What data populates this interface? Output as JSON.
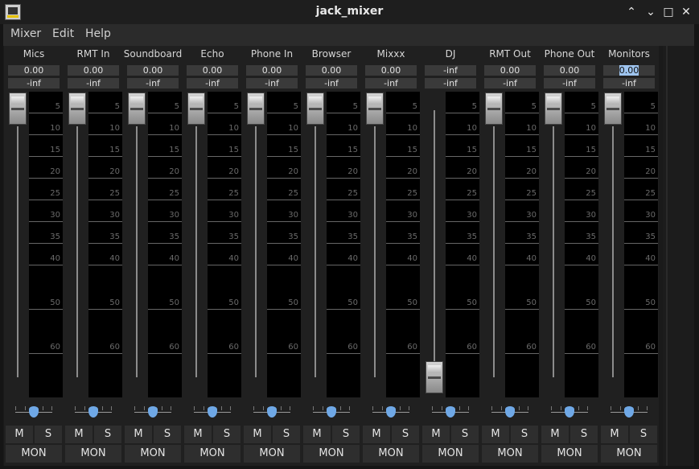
{
  "window": {
    "title": "jack_mixer",
    "controls": {
      "minimize": "⌃",
      "restore": "⌄",
      "maximize": "□",
      "close": "✕"
    }
  },
  "menu": [
    "Mixer",
    "Edit",
    "Help"
  ],
  "buttons": {
    "mute": "M",
    "solo": "S",
    "monitor": "MON"
  },
  "scale_labels": [
    "5",
    "10",
    "15",
    "20",
    "25",
    "30",
    "35",
    "40",
    "50",
    "60"
  ],
  "channels": [
    {
      "name": "Mics",
      "gain": "0.00",
      "peak": "-inf",
      "fader": "top"
    },
    {
      "name": "RMT In",
      "gain": "0.00",
      "peak": "-inf",
      "fader": "top"
    },
    {
      "name": "Soundboard",
      "gain": "0.00",
      "peak": "-inf",
      "fader": "top"
    },
    {
      "name": "Echo",
      "gain": "0.00",
      "peak": "-inf",
      "fader": "top"
    },
    {
      "name": "Phone In",
      "gain": "0.00",
      "peak": "-inf",
      "fader": "top"
    },
    {
      "name": "Browser",
      "gain": "0.00",
      "peak": "-inf",
      "fader": "top"
    },
    {
      "name": "Mixxx",
      "gain": "0.00",
      "peak": "-inf",
      "fader": "top"
    },
    {
      "name": "DJ",
      "gain": "-inf",
      "peak": "-inf",
      "fader": "bottom"
    },
    {
      "name": "RMT Out",
      "gain": "0.00",
      "peak": "-inf",
      "fader": "top"
    },
    {
      "name": "Phone Out",
      "gain": "0.00",
      "peak": "-inf",
      "fader": "top"
    },
    {
      "name": "Monitors",
      "gain": "0.00",
      "peak": "-inf",
      "fader": "top",
      "selected": true
    }
  ]
}
